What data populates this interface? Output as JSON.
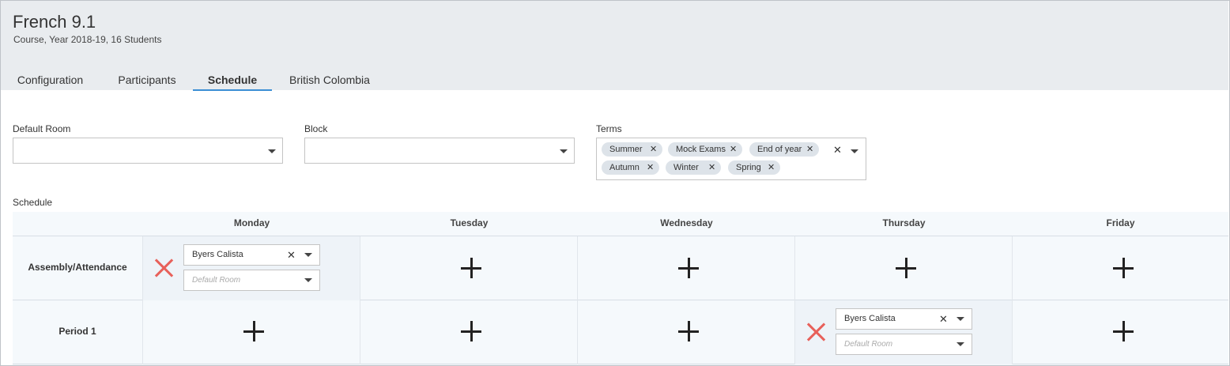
{
  "header": {
    "title": "French 9.1",
    "subtitle": "Course, Year 2018-19, 16 Students"
  },
  "tabs": [
    {
      "label": "Configuration",
      "active": false
    },
    {
      "label": "Participants",
      "active": false
    },
    {
      "label": "Schedule",
      "active": true
    },
    {
      "label": "British Colombia",
      "active": false
    }
  ],
  "fields": {
    "default_room": {
      "label": "Default Room",
      "value": ""
    },
    "block": {
      "label": "Block",
      "value": ""
    },
    "terms": {
      "label": "Terms",
      "selected": [
        "Summer",
        "Mock Exams",
        "End of year",
        "Autumn",
        "Winter",
        "Spring"
      ]
    }
  },
  "icons": {
    "chip_remove": "✕",
    "clear_all": "✕",
    "dropdown": "chevron-down-icon",
    "add_slot": "plus-icon",
    "remove_slot": "x-mark-icon"
  },
  "schedule": {
    "label": "Schedule",
    "days": [
      "Monday",
      "Tuesday",
      "Wednesday",
      "Thursday",
      "Friday"
    ],
    "periods": [
      {
        "name": "Assembly/Attendance",
        "cells": [
          {
            "teacher": "Byers Calista",
            "room_placeholder": "Default Room"
          },
          null,
          null,
          null,
          null
        ]
      },
      {
        "name": "Period 1",
        "cells": [
          null,
          null,
          null,
          {
            "teacher": "Byers Calista",
            "room_placeholder": "Default Room"
          },
          null
        ]
      }
    ]
  },
  "colors": {
    "header_bg": "#e9ecef",
    "active_tab_underline": "#3b8fd4",
    "remove_icon": "#e8605a",
    "grid_bg": "#f5f9fc"
  }
}
